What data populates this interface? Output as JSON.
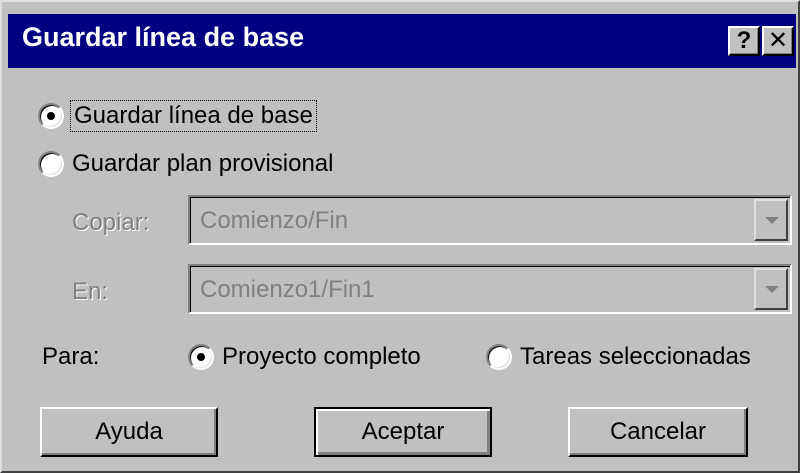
{
  "dialog": {
    "title": "Guardar línea de base",
    "help_glyph": "?",
    "close_glyph": "✕"
  },
  "options": {
    "save_baseline": {
      "label": "Guardar línea de base",
      "checked": true
    },
    "save_interim": {
      "label": "Guardar plan provisional",
      "checked": false
    }
  },
  "copy_field": {
    "label": "Copiar:",
    "value": "Comienzo/Fin",
    "enabled": false
  },
  "into_field": {
    "label": "En:",
    "value": "Comienzo1/Fin1",
    "enabled": false
  },
  "scope": {
    "label": "Para:",
    "entire_project": {
      "label": "Proyecto completo",
      "checked": true
    },
    "selected_tasks": {
      "label": "Tareas seleccionadas",
      "checked": false
    }
  },
  "buttons": {
    "help": "Ayuda",
    "ok": "Aceptar",
    "cancel": "Cancelar"
  },
  "icons": {
    "help": "question-mark-icon",
    "close": "close-icon",
    "dropdown": "chevron-down-icon"
  },
  "colors": {
    "titlebar": "#000080",
    "face": "#c0c0c0",
    "disabled_text": "#808080"
  }
}
